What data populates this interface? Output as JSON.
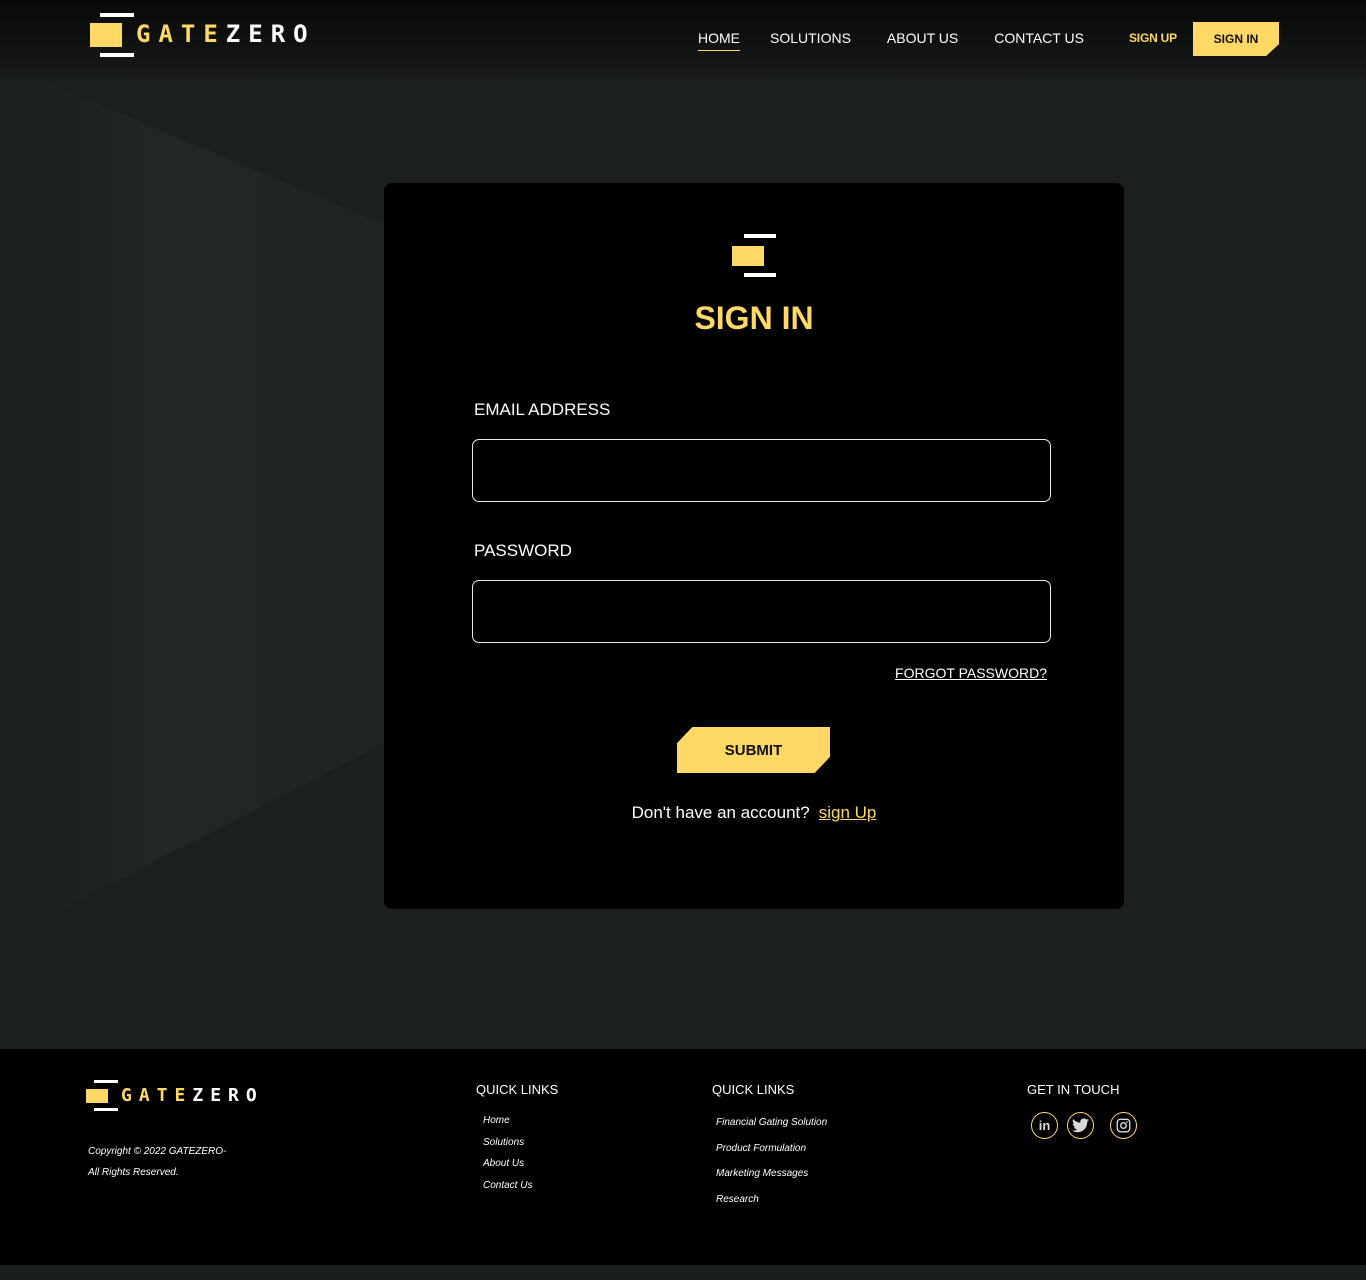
{
  "brand": {
    "part1": "GATE",
    "part2": "ZERO"
  },
  "nav": {
    "items": [
      {
        "label": "HOME",
        "active": true
      },
      {
        "label": "SOLUTIONS"
      },
      {
        "label": "ABOUT US"
      },
      {
        "label": "CONTACT US"
      }
    ],
    "signup_label": "SIGN UP",
    "signin_label": "SIGN IN"
  },
  "form": {
    "title": "SIGN IN",
    "email_label": "EMAIL ADDRESS",
    "email_value": "",
    "password_label": "PASSWORD",
    "password_value": "",
    "forgot_label": "FORGOT PASSWORD?",
    "submit_label": "SUBMIT",
    "no_account_text": "Don't have an account?",
    "signup_link": "sign Up"
  },
  "footer": {
    "copyright_line1": "Copyright © 2022 GATEZERO-",
    "copyright_line2": "All Rights Reserved.",
    "col1_title": "QUICK LINKS",
    "col1_items": [
      "Home",
      "Solutions",
      "About Us",
      "Contact Us"
    ],
    "col2_title": "QUICK LINKS",
    "col2_items": [
      "Financial Gating Solution",
      "Product Formulation",
      "Marketing Messages",
      "Research"
    ],
    "col3_title": "GET IN TOUCH",
    "social": [
      "linkedin-icon",
      "twitter-icon",
      "instagram-icon"
    ]
  },
  "colors": {
    "accent": "#ffd866",
    "background": "#1b1e1e",
    "card": "#000000"
  }
}
